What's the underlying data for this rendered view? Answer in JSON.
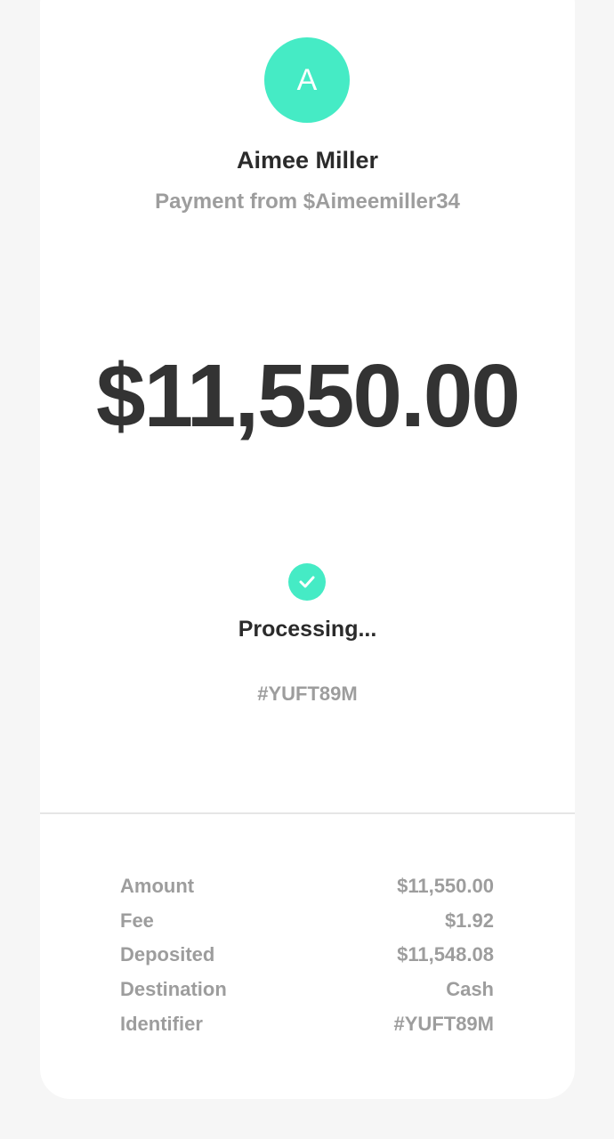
{
  "theme": {
    "accent": "#45ebc5"
  },
  "sender": {
    "avatar_initial": "A",
    "name": "Aimee Miller",
    "subtitle": "Payment from $Aimeemiller34"
  },
  "payment": {
    "amount": "$11,550.00",
    "status_icon": "check-icon",
    "status": "Processing...",
    "id": "#YUFT89M"
  },
  "details": [
    {
      "label": "Amount",
      "value": "$11,550.00"
    },
    {
      "label": "Fee",
      "value": "$1.92"
    },
    {
      "label": "Deposited",
      "value": "$11,548.08"
    },
    {
      "label": "Destination",
      "value": "Cash"
    },
    {
      "label": "Identifier",
      "value": "#YUFT89M"
    }
  ]
}
